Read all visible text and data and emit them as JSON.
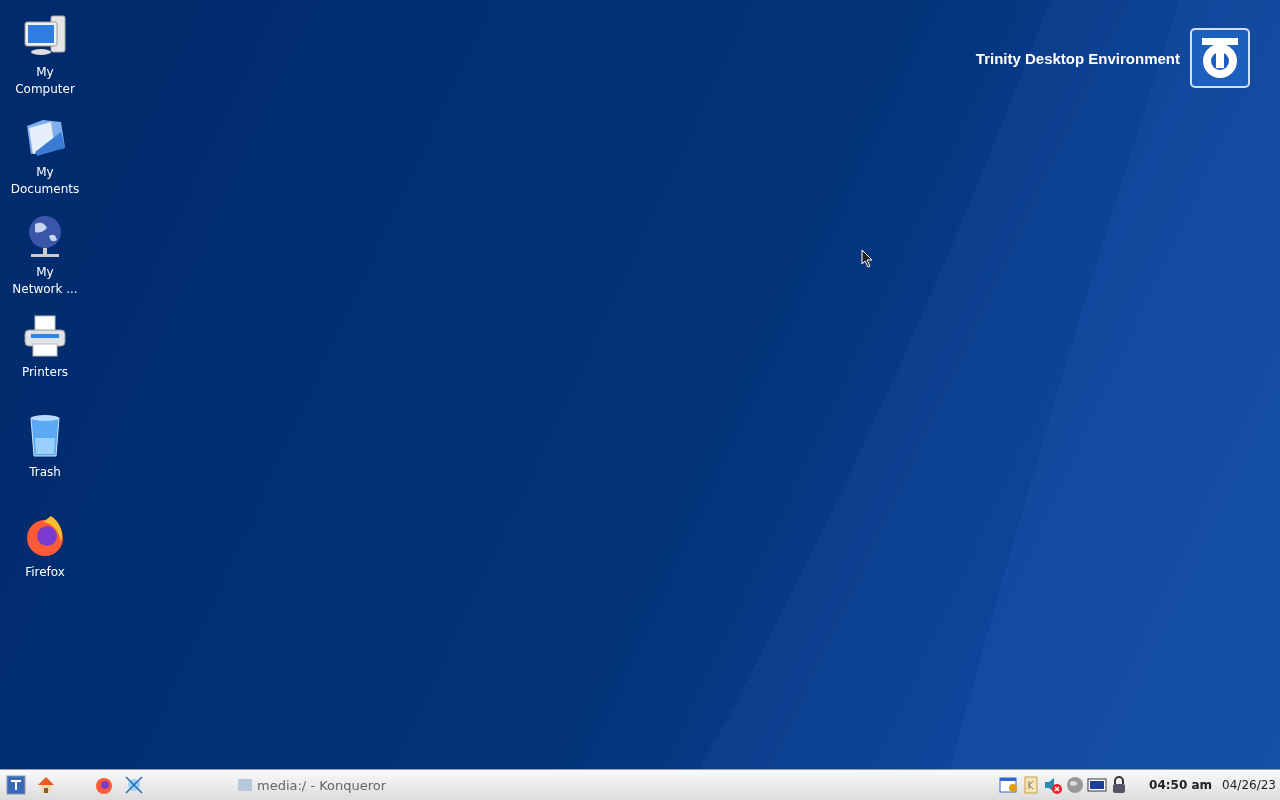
{
  "desktop_icons": [
    {
      "label": "My Computer",
      "kind": "computer"
    },
    {
      "label": "My Documents",
      "kind": "documents"
    },
    {
      "label": "My Network ...",
      "kind": "network"
    },
    {
      "label": "Printers",
      "kind": "printer"
    },
    {
      "label": "Trash",
      "kind": "trash"
    },
    {
      "label": "Firefox",
      "kind": "firefox"
    }
  ],
  "branding": {
    "text": "Trinity Desktop Environment"
  },
  "taskbar": {
    "launchers": [
      {
        "kind": "start"
      },
      {
        "kind": "home"
      },
      {
        "kind": "firefox"
      },
      {
        "kind": "konqueror"
      }
    ],
    "task": {
      "title": "media:/ - Konqueror"
    },
    "tray": [
      {
        "kind": "calendar"
      },
      {
        "kind": "klipper"
      },
      {
        "kind": "volume-muted"
      },
      {
        "kind": "globe"
      },
      {
        "kind": "display"
      },
      {
        "kind": "lock"
      }
    ],
    "clock": {
      "time": "04:50 am",
      "date": "04/26/23"
    }
  }
}
